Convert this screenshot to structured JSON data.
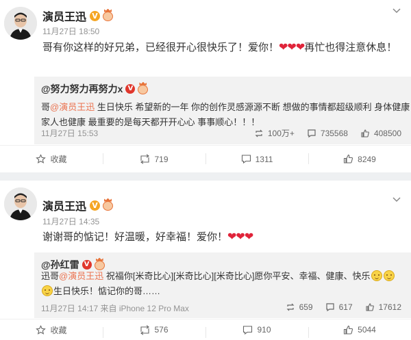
{
  "posts": [
    {
      "author": "演员王迅",
      "verified_badge": "V",
      "timestamp": "11月27日 18:50",
      "text_before_hearts": "哥有你这样的好兄弟，已经很开心很快乐了！爱你！",
      "hearts": "❤❤❤",
      "text_after_hearts": "再忙也得注意休息！",
      "repost": {
        "author": "@努力努力再努力x",
        "badge": "V",
        "text_prefix": "哥",
        "mention": "@演员王迅",
        "text_body": " 生日快乐 希望新的一年 你的创作灵感源源不断 想做的事情都超级顺利 身体健康 家人也健康 最重要的是每天都开开心心 事事顺心！！！",
        "meta": "11月27日 15:53",
        "stats": {
          "reposts": "100万+",
          "comments": "735568",
          "likes": "408500"
        }
      },
      "actions": {
        "favorite": "收藏",
        "repost": "719",
        "comment": "1311",
        "like": "8249"
      }
    },
    {
      "author": "演员王迅",
      "verified_badge": "V",
      "timestamp": "11月27日 14:35",
      "text_before_hearts": "谢谢哥的惦记！好温暖，好幸福！爱你！",
      "hearts": "❤❤❤",
      "text_after_hearts": "",
      "repost": {
        "author": "@孙红雷",
        "badge": "V",
        "text_prefix": "迅哥",
        "mention": "@演员王迅",
        "text_body": " 祝福你[米奇比心][米奇比心][米奇比心]愿你平安、幸福、健康、快乐",
        "text_line2": "生日快乐！惦记你的哥……",
        "meta": "11月27日 14:17 来自 iPhone 12 Pro Max",
        "stats": {
          "reposts": "659",
          "comments": "617",
          "likes": "17612"
        }
      },
      "actions": {
        "favorite": "收藏",
        "repost": "576",
        "comment": "910",
        "like": "5044"
      }
    }
  ],
  "colors": {
    "mention": "#eb7350",
    "heart": "#e0243a",
    "verified_gold": "#f5a623",
    "verified_red": "#e0362c",
    "repost_bg": "#f2f2f2"
  },
  "icons": [
    "chevron-down-icon",
    "star-icon",
    "repost-icon",
    "comment-icon",
    "like-icon",
    "smile-emoji-icon"
  ]
}
